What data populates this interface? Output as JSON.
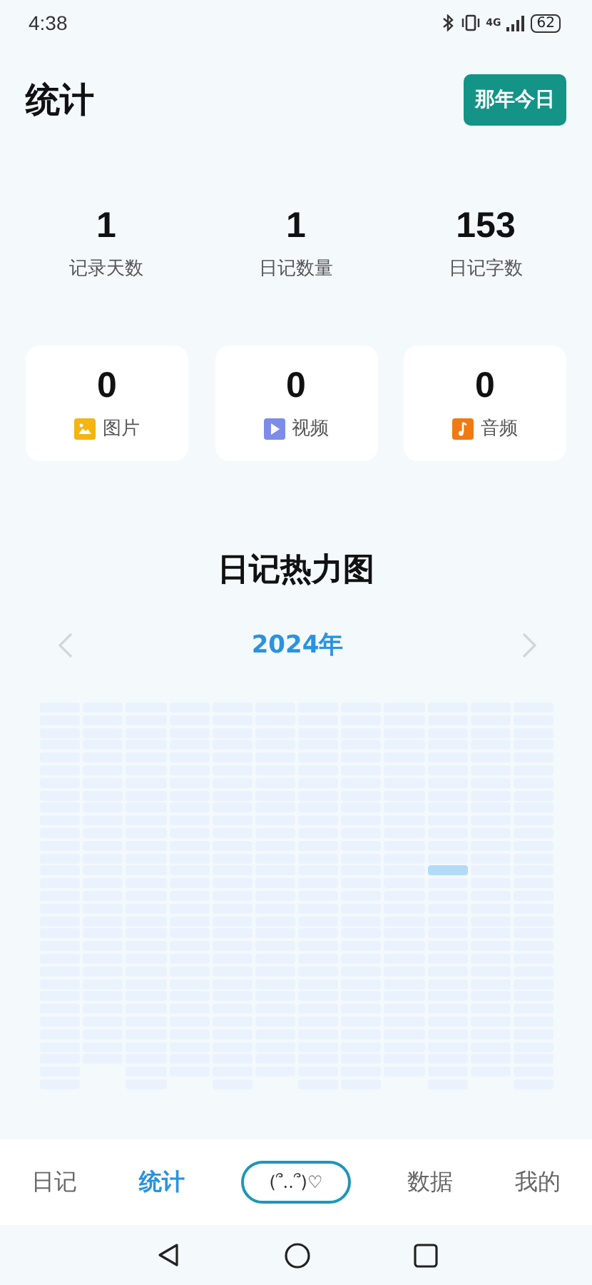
{
  "status_bar": {
    "time": "4:38",
    "network": "4G",
    "battery": "62"
  },
  "header": {
    "title": "统计",
    "button": "那年今日"
  },
  "stats": [
    {
      "value": "1",
      "label": "记录天数"
    },
    {
      "value": "1",
      "label": "日记数量"
    },
    {
      "value": "153",
      "label": "日记字数"
    }
  ],
  "media": [
    {
      "kind": "image",
      "value": "0",
      "label": "图片"
    },
    {
      "kind": "video",
      "value": "0",
      "label": "视频"
    },
    {
      "kind": "audio",
      "value": "0",
      "label": "音频"
    }
  ],
  "heatmap": {
    "title": "日记热力图",
    "year": "2024年",
    "months": [
      {
        "days": [
          {
            "active": false
          },
          {
            "active": false
          },
          {
            "active": false
          },
          {
            "active": false
          },
          {
            "active": false
          },
          {
            "active": false
          },
          {
            "active": false
          },
          {
            "active": false
          },
          {
            "active": false
          },
          {
            "active": false
          },
          {
            "active": false
          },
          {
            "active": false
          },
          {
            "active": false
          },
          {
            "active": false
          },
          {
            "active": false
          },
          {
            "active": false
          },
          {
            "active": false
          },
          {
            "active": false
          },
          {
            "active": false
          },
          {
            "active": false
          },
          {
            "active": false
          },
          {
            "active": false
          },
          {
            "active": false
          },
          {
            "active": false
          },
          {
            "active": false
          },
          {
            "active": false
          },
          {
            "active": false
          },
          {
            "active": false
          },
          {
            "active": false
          },
          {
            "active": false
          },
          {
            "active": false
          }
        ]
      },
      {
        "days": [
          {
            "active": false
          },
          {
            "active": false
          },
          {
            "active": false
          },
          {
            "active": false
          },
          {
            "active": false
          },
          {
            "active": false
          },
          {
            "active": false
          },
          {
            "active": false
          },
          {
            "active": false
          },
          {
            "active": false
          },
          {
            "active": false
          },
          {
            "active": false
          },
          {
            "active": false
          },
          {
            "active": false
          },
          {
            "active": false
          },
          {
            "active": false
          },
          {
            "active": false
          },
          {
            "active": false
          },
          {
            "active": false
          },
          {
            "active": false
          },
          {
            "active": false
          },
          {
            "active": false
          },
          {
            "active": false
          },
          {
            "active": false
          },
          {
            "active": false
          },
          {
            "active": false
          },
          {
            "active": false
          },
          {
            "active": false
          },
          {
            "active": false
          }
        ]
      },
      {
        "days": [
          {
            "active": false
          },
          {
            "active": false
          },
          {
            "active": false
          },
          {
            "active": false
          },
          {
            "active": false
          },
          {
            "active": false
          },
          {
            "active": false
          },
          {
            "active": false
          },
          {
            "active": false
          },
          {
            "active": false
          },
          {
            "active": false
          },
          {
            "active": false
          },
          {
            "active": false
          },
          {
            "active": false
          },
          {
            "active": false
          },
          {
            "active": false
          },
          {
            "active": false
          },
          {
            "active": false
          },
          {
            "active": false
          },
          {
            "active": false
          },
          {
            "active": false
          },
          {
            "active": false
          },
          {
            "active": false
          },
          {
            "active": false
          },
          {
            "active": false
          },
          {
            "active": false
          },
          {
            "active": false
          },
          {
            "active": false
          },
          {
            "active": false
          },
          {
            "active": false
          },
          {
            "active": false
          }
        ]
      },
      {
        "days": [
          {
            "active": false
          },
          {
            "active": false
          },
          {
            "active": false
          },
          {
            "active": false
          },
          {
            "active": false
          },
          {
            "active": false
          },
          {
            "active": false
          },
          {
            "active": false
          },
          {
            "active": false
          },
          {
            "active": false
          },
          {
            "active": false
          },
          {
            "active": false
          },
          {
            "active": false
          },
          {
            "active": false
          },
          {
            "active": false
          },
          {
            "active": false
          },
          {
            "active": false
          },
          {
            "active": false
          },
          {
            "active": false
          },
          {
            "active": false
          },
          {
            "active": false
          },
          {
            "active": false
          },
          {
            "active": false
          },
          {
            "active": false
          },
          {
            "active": false
          },
          {
            "active": false
          },
          {
            "active": false
          },
          {
            "active": false
          },
          {
            "active": false
          },
          {
            "active": false
          }
        ]
      },
      {
        "days": [
          {
            "active": false
          },
          {
            "active": false
          },
          {
            "active": false
          },
          {
            "active": false
          },
          {
            "active": false
          },
          {
            "active": false
          },
          {
            "active": false
          },
          {
            "active": false
          },
          {
            "active": false
          },
          {
            "active": false
          },
          {
            "active": false
          },
          {
            "active": false
          },
          {
            "active": false
          },
          {
            "active": false
          },
          {
            "active": false
          },
          {
            "active": false
          },
          {
            "active": false
          },
          {
            "active": false
          },
          {
            "active": false
          },
          {
            "active": false
          },
          {
            "active": false
          },
          {
            "active": false
          },
          {
            "active": false
          },
          {
            "active": false
          },
          {
            "active": false
          },
          {
            "active": false
          },
          {
            "active": false
          },
          {
            "active": false
          },
          {
            "active": false
          },
          {
            "active": false
          },
          {
            "active": false
          }
        ]
      },
      {
        "days": [
          {
            "active": false
          },
          {
            "active": false
          },
          {
            "active": false
          },
          {
            "active": false
          },
          {
            "active": false
          },
          {
            "active": false
          },
          {
            "active": false
          },
          {
            "active": false
          },
          {
            "active": false
          },
          {
            "active": false
          },
          {
            "active": false
          },
          {
            "active": false
          },
          {
            "active": false
          },
          {
            "active": false
          },
          {
            "active": false
          },
          {
            "active": false
          },
          {
            "active": false
          },
          {
            "active": false
          },
          {
            "active": false
          },
          {
            "active": false
          },
          {
            "active": false
          },
          {
            "active": false
          },
          {
            "active": false
          },
          {
            "active": false
          },
          {
            "active": false
          },
          {
            "active": false
          },
          {
            "active": false
          },
          {
            "active": false
          },
          {
            "active": false
          },
          {
            "active": false
          }
        ]
      },
      {
        "days": [
          {
            "active": false
          },
          {
            "active": false
          },
          {
            "active": false
          },
          {
            "active": false
          },
          {
            "active": false
          },
          {
            "active": false
          },
          {
            "active": false
          },
          {
            "active": false
          },
          {
            "active": false
          },
          {
            "active": false
          },
          {
            "active": false
          },
          {
            "active": false
          },
          {
            "active": false
          },
          {
            "active": false
          },
          {
            "active": false
          },
          {
            "active": false
          },
          {
            "active": false
          },
          {
            "active": false
          },
          {
            "active": false
          },
          {
            "active": false
          },
          {
            "active": false
          },
          {
            "active": false
          },
          {
            "active": false
          },
          {
            "active": false
          },
          {
            "active": false
          },
          {
            "active": false
          },
          {
            "active": false
          },
          {
            "active": false
          },
          {
            "active": false
          },
          {
            "active": false
          },
          {
            "active": false
          }
        ]
      },
      {
        "days": [
          {
            "active": false
          },
          {
            "active": false
          },
          {
            "active": false
          },
          {
            "active": false
          },
          {
            "active": false
          },
          {
            "active": false
          },
          {
            "active": false
          },
          {
            "active": false
          },
          {
            "active": false
          },
          {
            "active": false
          },
          {
            "active": false
          },
          {
            "active": false
          },
          {
            "active": false
          },
          {
            "active": false
          },
          {
            "active": false
          },
          {
            "active": false
          },
          {
            "active": false
          },
          {
            "active": false
          },
          {
            "active": false
          },
          {
            "active": false
          },
          {
            "active": false
          },
          {
            "active": false
          },
          {
            "active": false
          },
          {
            "active": false
          },
          {
            "active": false
          },
          {
            "active": false
          },
          {
            "active": false
          },
          {
            "active": false
          },
          {
            "active": false
          },
          {
            "active": false
          },
          {
            "active": false
          }
        ]
      },
      {
        "days": [
          {
            "active": false
          },
          {
            "active": false
          },
          {
            "active": false
          },
          {
            "active": false
          },
          {
            "active": false
          },
          {
            "active": false
          },
          {
            "active": false
          },
          {
            "active": false
          },
          {
            "active": false
          },
          {
            "active": false
          },
          {
            "active": false
          },
          {
            "active": false
          },
          {
            "active": false
          },
          {
            "active": false
          },
          {
            "active": false
          },
          {
            "active": false
          },
          {
            "active": false
          },
          {
            "active": false
          },
          {
            "active": false
          },
          {
            "active": false
          },
          {
            "active": false
          },
          {
            "active": false
          },
          {
            "active": false
          },
          {
            "active": false
          },
          {
            "active": false
          },
          {
            "active": false
          },
          {
            "active": false
          },
          {
            "active": false
          },
          {
            "active": false
          },
          {
            "active": false
          }
        ]
      },
      {
        "days": [
          {
            "active": false
          },
          {
            "active": false
          },
          {
            "active": false
          },
          {
            "active": false
          },
          {
            "active": false
          },
          {
            "active": false
          },
          {
            "active": false
          },
          {
            "active": false
          },
          {
            "active": false
          },
          {
            "active": false
          },
          {
            "active": false
          },
          {
            "active": false
          },
          {
            "active": false
          },
          {
            "active": true
          },
          {
            "active": false
          },
          {
            "active": false
          },
          {
            "active": false
          },
          {
            "active": false
          },
          {
            "active": false
          },
          {
            "active": false
          },
          {
            "active": false
          },
          {
            "active": false
          },
          {
            "active": false
          },
          {
            "active": false
          },
          {
            "active": false
          },
          {
            "active": false
          },
          {
            "active": false
          },
          {
            "active": false
          },
          {
            "active": false
          },
          {
            "active": false
          },
          {
            "active": false
          }
        ]
      },
      {
        "days": [
          {
            "active": false
          },
          {
            "active": false
          },
          {
            "active": false
          },
          {
            "active": false
          },
          {
            "active": false
          },
          {
            "active": false
          },
          {
            "active": false
          },
          {
            "active": false
          },
          {
            "active": false
          },
          {
            "active": false
          },
          {
            "active": false
          },
          {
            "active": false
          },
          {
            "active": false
          },
          {
            "active": false
          },
          {
            "active": false
          },
          {
            "active": false
          },
          {
            "active": false
          },
          {
            "active": false
          },
          {
            "active": false
          },
          {
            "active": false
          },
          {
            "active": false
          },
          {
            "active": false
          },
          {
            "active": false
          },
          {
            "active": false
          },
          {
            "active": false
          },
          {
            "active": false
          },
          {
            "active": false
          },
          {
            "active": false
          },
          {
            "active": false
          },
          {
            "active": false
          }
        ]
      },
      {
        "days": [
          {
            "active": false
          },
          {
            "active": false
          },
          {
            "active": false
          },
          {
            "active": false
          },
          {
            "active": false
          },
          {
            "active": false
          },
          {
            "active": false
          },
          {
            "active": false
          },
          {
            "active": false
          },
          {
            "active": false
          },
          {
            "active": false
          },
          {
            "active": false
          },
          {
            "active": false
          },
          {
            "active": false
          },
          {
            "active": false
          },
          {
            "active": false
          },
          {
            "active": false
          },
          {
            "active": false
          },
          {
            "active": false
          },
          {
            "active": false
          },
          {
            "active": false
          },
          {
            "active": false
          },
          {
            "active": false
          },
          {
            "active": false
          },
          {
            "active": false
          },
          {
            "active": false
          },
          {
            "active": false
          },
          {
            "active": false
          },
          {
            "active": false
          },
          {
            "active": false
          },
          {
            "active": false
          }
        ]
      }
    ]
  },
  "tabs": [
    {
      "kind": "text",
      "label": "日记",
      "selected": false
    },
    {
      "kind": "text",
      "label": "统计",
      "selected": true
    },
    {
      "kind": "pill",
      "label": "(՞..՞)♡",
      "selected": false
    },
    {
      "kind": "text",
      "label": "数据",
      "selected": false
    },
    {
      "kind": "text",
      "label": "我的",
      "selected": false
    }
  ]
}
